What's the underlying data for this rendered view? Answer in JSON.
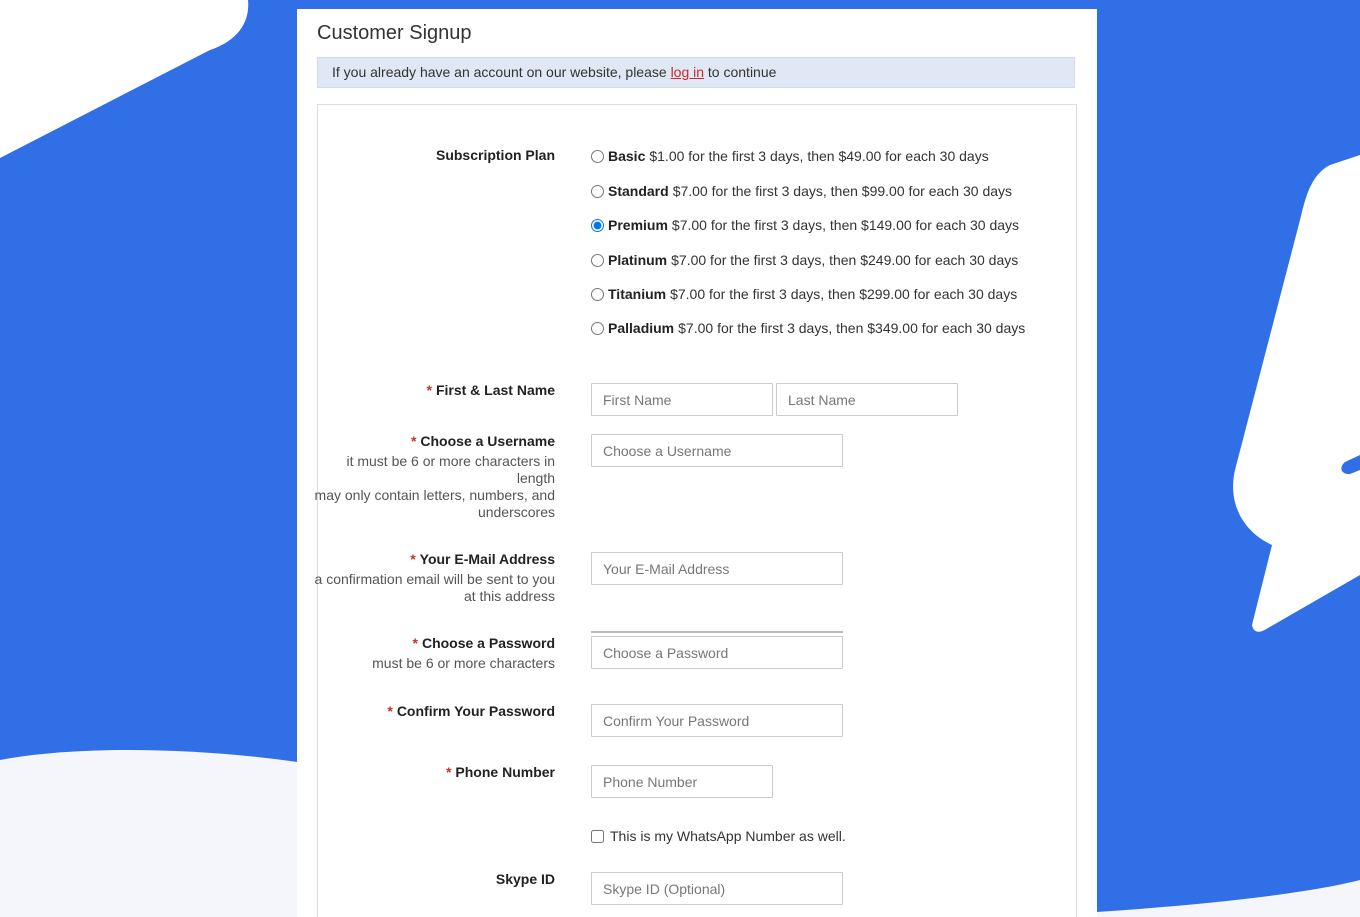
{
  "page": {
    "title": "Customer Signup",
    "notice_before": "If you already have an account on our website, please ",
    "notice_link": "log in",
    "notice_after": " to continue"
  },
  "subscription": {
    "label": "Subscription Plan",
    "selected": "Premium",
    "plans": [
      {
        "name": "Basic",
        "desc": "$1.00 for the first 3 days, then $49.00 for each 30 days"
      },
      {
        "name": "Standard",
        "desc": "$7.00 for the first 3 days, then $99.00 for each 30 days"
      },
      {
        "name": "Premium",
        "desc": "$7.00 for the first 3 days, then $149.00 for each 30 days"
      },
      {
        "name": "Platinum",
        "desc": "$7.00 for the first 3 days, then $249.00 for each 30 days"
      },
      {
        "name": "Titanium",
        "desc": "$7.00 for the first 3 days, then $299.00 for each 30 days"
      },
      {
        "name": "Palladium",
        "desc": "$7.00 for the first 3 days, then $349.00 for each 30 days"
      }
    ]
  },
  "fields": {
    "required_mark": "*",
    "name": {
      "label": "First & Last Name",
      "first_placeholder": "First Name",
      "last_placeholder": "Last Name"
    },
    "username": {
      "label": "Choose a Username",
      "hint1": "it must be 6 or more characters in length",
      "hint2": "may only contain letters, numbers, and underscores",
      "placeholder": "Choose a Username"
    },
    "email": {
      "label": "Your E-Mail Address",
      "hint": "a confirmation email will be sent to you at this address",
      "placeholder": "Your E-Mail Address"
    },
    "password": {
      "label": "Choose a Password",
      "hint": "must be 6 or more characters",
      "placeholder": "Choose a Password"
    },
    "confirm": {
      "label": "Confirm Your Password",
      "placeholder": "Confirm Your Password"
    },
    "phone": {
      "label": "Phone Number",
      "placeholder": "Phone Number"
    },
    "whatsapp": {
      "label": "This is my WhatsApp Number as well.",
      "checked": false
    },
    "skype": {
      "label": "Skype ID",
      "placeholder": "Skype ID (Optional)"
    }
  },
  "colors": {
    "background": "#316fe7",
    "shape": "#ffffff",
    "bottom_shape": "#f4f6fb",
    "notice_bg": "#dfe8f4",
    "link": "#d0262d",
    "required": "#c9302c"
  }
}
